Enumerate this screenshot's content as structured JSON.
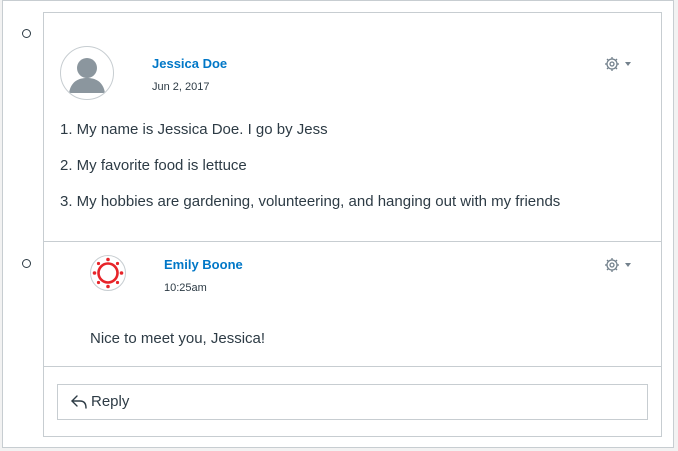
{
  "entries": [
    {
      "author": "Jessica Doe",
      "date": "Jun 2, 2017",
      "lines": [
        "1. My name is Jessica Doe. I go by Jess",
        "2. My favorite food is lettuce",
        "3. My hobbies are gardening, volunteering, and hanging out with my friends"
      ],
      "avatar": "default-person-icon"
    },
    {
      "author": "Emily Boone",
      "date": "10:25am",
      "message": "Nice to meet you, Jessica!",
      "avatar": "canvas-logo-icon"
    }
  ],
  "reply": {
    "label": "Reply",
    "icon": "reply-arrow-icon"
  },
  "colors": {
    "link": "#0077c7",
    "text": "#2d3b45",
    "border": "#c7cdd1",
    "logo": "#e72429"
  }
}
